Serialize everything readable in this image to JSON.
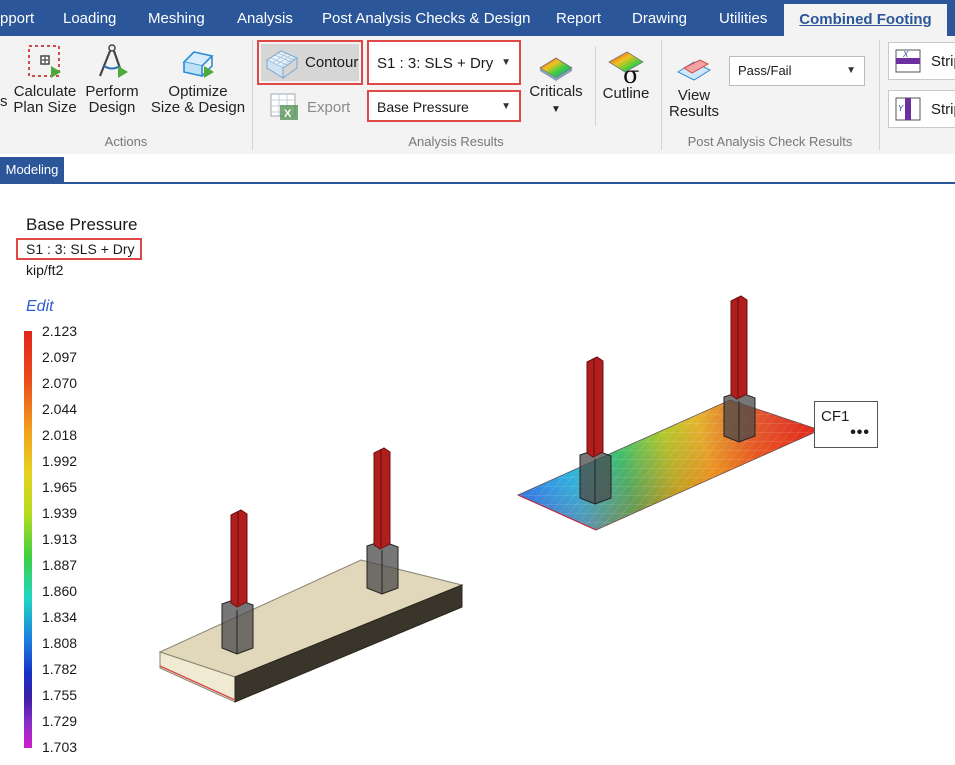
{
  "menu": {
    "items": [
      "pport",
      "Loading",
      "Meshing",
      "Analysis",
      "Post Analysis Checks & Design",
      "Report",
      "Drawing",
      "Utilities"
    ],
    "active": "Combined Footing"
  },
  "ribbon": {
    "actions": {
      "group_label": "Actions",
      "calc_line1": "Calculate",
      "calc_line2": "Plan Size",
      "perform_line1": "Perform",
      "perform_line2": "Design",
      "optimize_line1": "Optimize",
      "optimize_line2": "Size & Design",
      "partial_left": "s"
    },
    "analysis_results": {
      "group_label": "Analysis Results",
      "contour": "Contour",
      "load_case": "S1 : 3: SLS + Dry",
      "export": "Export",
      "result_type": "Base Pressure",
      "criticals": "Criticals",
      "cutline": "Cutline"
    },
    "post_analysis": {
      "group_label": "Post Analysis Check Results",
      "view_line1": "View",
      "view_line2": "Results",
      "passfail": "Pass/Fail"
    },
    "strip1": "Strip",
    "strip2": "Strip"
  },
  "tabs": {
    "modeling": "Modeling"
  },
  "legend": {
    "title": "Base Pressure",
    "case": "S1 : 3: SLS + Dry",
    "unit": "kip/ft2",
    "edit": "Edit",
    "ticks": [
      "2.123",
      "2.097",
      "2.070",
      "2.044",
      "2.018",
      "1.992",
      "1.965",
      "1.939",
      "1.913",
      "1.887",
      "1.860",
      "1.834",
      "1.808",
      "1.782",
      "1.755",
      "1.729",
      "1.703"
    ]
  },
  "model": {
    "footing_label": "CF1",
    "more": "•••"
  },
  "colors": {
    "menubar": "#2b579a",
    "highlight": "#e04848",
    "column": "#b01e1e",
    "footing": "#e3dcc0"
  }
}
